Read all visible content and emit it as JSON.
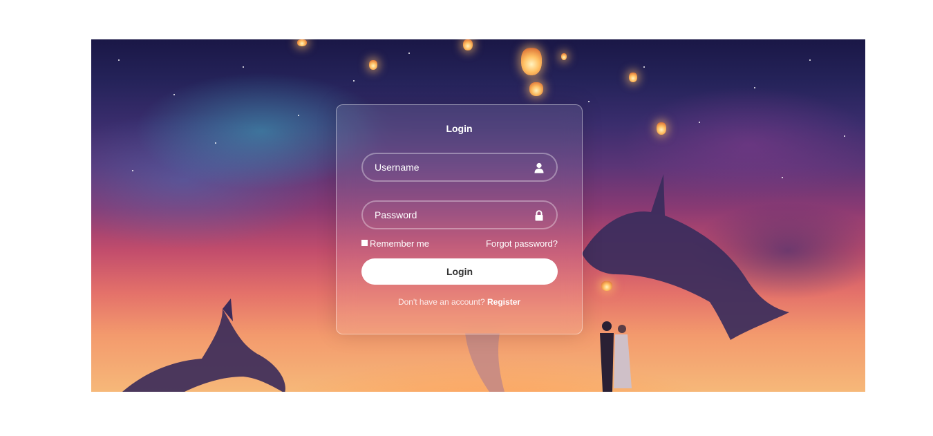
{
  "login_form": {
    "title": "Login",
    "username": {
      "placeholder": "Username",
      "icon": "user-icon"
    },
    "password": {
      "placeholder": "Password",
      "icon": "lock-icon"
    },
    "remember_label": "Remember me",
    "forgot_link": "Forgot password?",
    "submit_label": "Login",
    "register_prompt": "Don't have an account?",
    "register_link": "Register"
  },
  "colors": {
    "card_border": "#ffffff",
    "button_background": "#ffffff",
    "button_text": "#333333",
    "text": "#ffffff"
  }
}
